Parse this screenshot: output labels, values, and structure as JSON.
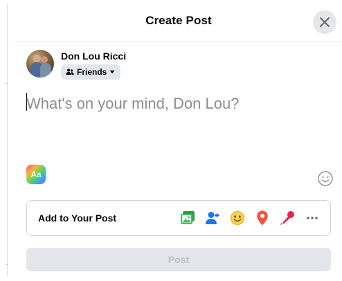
{
  "header": {
    "title": "Create Post"
  },
  "author": {
    "name": "Don Lou Ricci",
    "audience": "Friends"
  },
  "composer": {
    "placeholder": "What's on your mind, Don Lou?"
  },
  "background_picker": {
    "label": "Aa"
  },
  "add_to_post": {
    "label": "Add to Your Post",
    "icons": [
      "photo-video-icon",
      "tag-people-icon",
      "feeling-activity-icon",
      "check-in-icon",
      "host-qa-icon",
      "more-icon"
    ]
  },
  "post_button": {
    "label": "Post"
  },
  "colors": {
    "photo": "#45bd62",
    "tag": "#1877f2",
    "feeling": "#f7b928",
    "checkin": "#f5533d",
    "qa": "#e42645",
    "disabled_button": "#e4e6eb"
  }
}
